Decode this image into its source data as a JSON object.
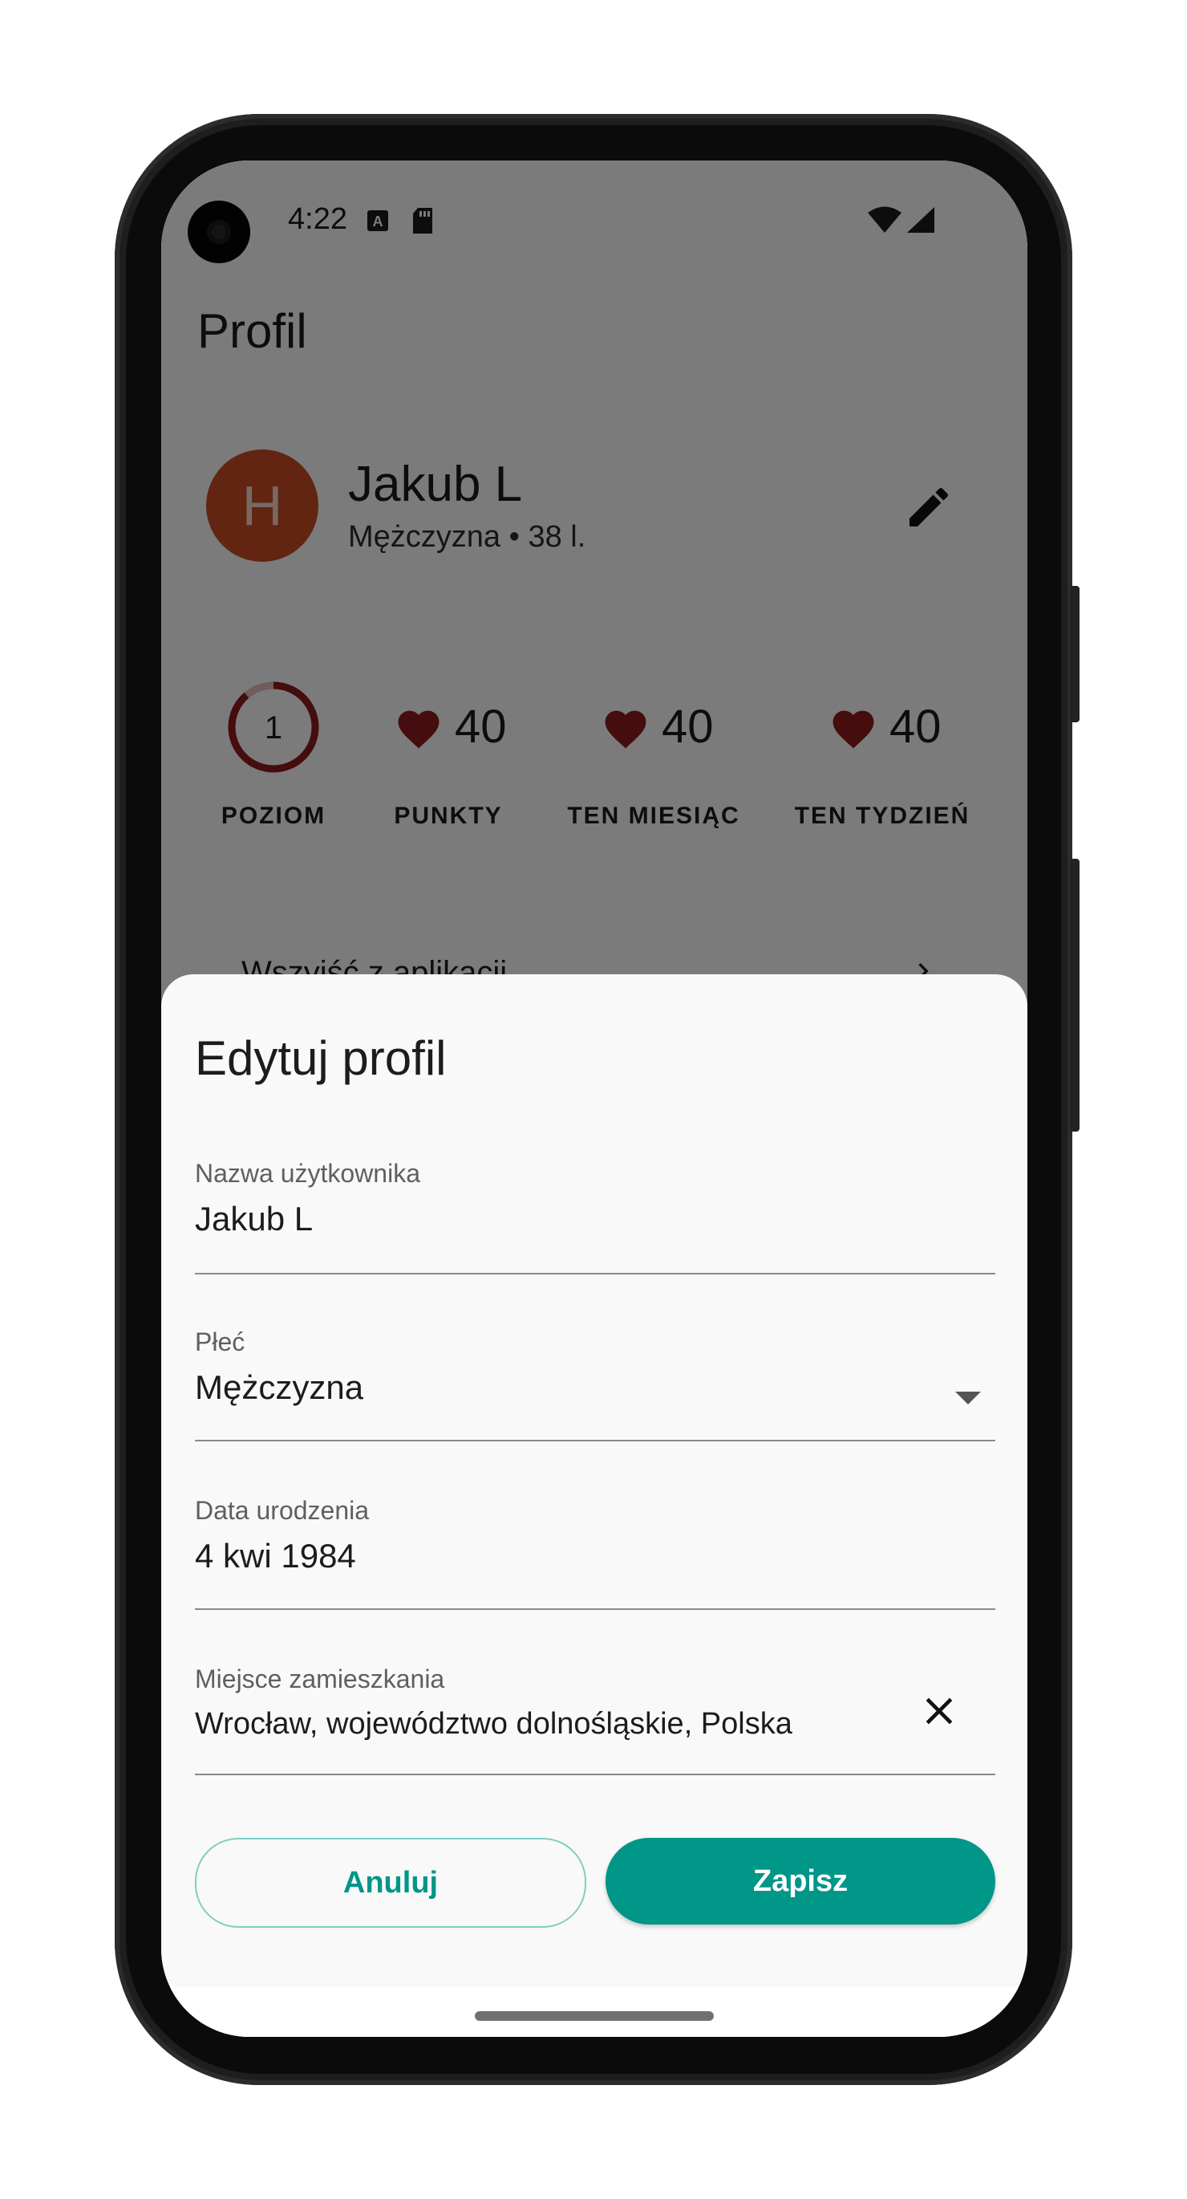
{
  "status_bar": {
    "time": "4:22"
  },
  "profile": {
    "page_title": "Profil",
    "avatar_letter": "H",
    "name": "Jakub L",
    "subtitle": "Mężczyzna • 38 l.",
    "hidden_row": "Wszyjść z aplikacji"
  },
  "stats": [
    {
      "value": "1",
      "label": "POZIOM"
    },
    {
      "value": "40",
      "label": "PUNKTY"
    },
    {
      "value": "40",
      "label": "TEN MIESIĄC"
    },
    {
      "value": "40",
      "label": "TEN TYDZIEŃ"
    }
  ],
  "sheet": {
    "title": "Edytuj profil",
    "fields": {
      "username": {
        "label": "Nazwa użytkownika",
        "value": "Jakub L"
      },
      "gender": {
        "label": "Płeć",
        "value": "Mężczyzna"
      },
      "birthdate": {
        "label": "Data urodzenia",
        "value": "4 kwi 1984"
      },
      "location": {
        "label": "Miejsce zamieszkania",
        "value": "Wrocław, województwo dolnośląskie, Polska"
      }
    },
    "cancel_label": "Anuluj",
    "save_label": "Zapisz"
  },
  "colors": {
    "accent": "#009688",
    "avatar": "#c24b22",
    "heart": "#8b1a1a",
    "level_ring": "#8b1a1a"
  }
}
